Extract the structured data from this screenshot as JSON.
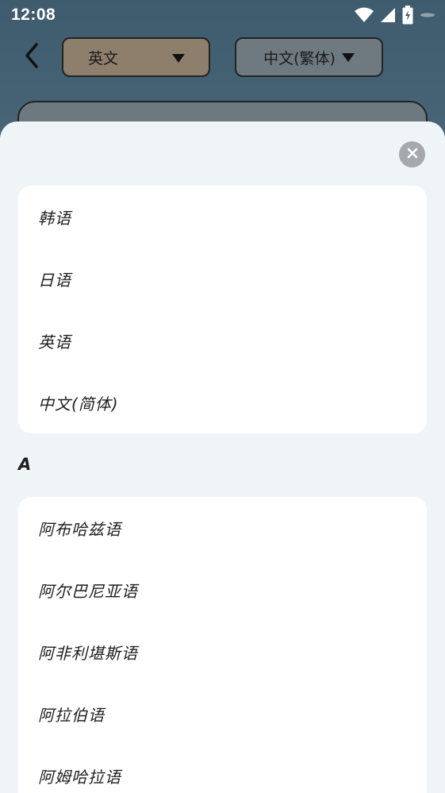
{
  "status_bar": {
    "time": "12:08",
    "icons": [
      "wifi-icon",
      "cellular-signal-icon",
      "battery-charging-icon",
      "notification-dot-icon"
    ]
  },
  "header": {
    "back_icon": "chevron-left-icon",
    "source_language": "英文",
    "target_language": "中文(繁体)"
  },
  "sheet": {
    "close_icon": "close-icon",
    "recent_languages": [
      "韩语",
      "日语",
      "英语",
      "中文(简体)"
    ],
    "sections": [
      {
        "letter": "A",
        "languages": [
          "阿布哈兹语",
          "阿尔巴尼亚语",
          "阿非利堪斯语",
          "阿拉伯语",
          "阿姆哈拉语"
        ]
      }
    ]
  },
  "colors": {
    "sheet_background": "#eff4f7",
    "card_background": "#ffffff",
    "close_button": "#a6a9ac",
    "source_select": "#8e7f6d",
    "target_select": "#6f7a80"
  }
}
